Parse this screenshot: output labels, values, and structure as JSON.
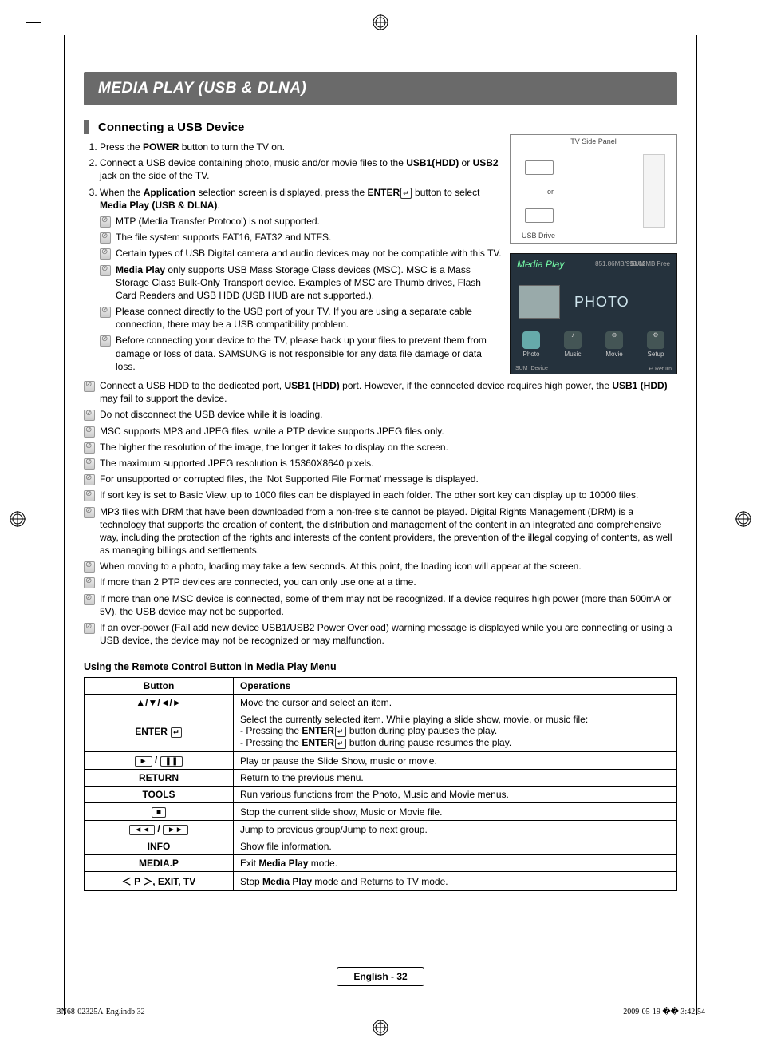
{
  "header": {
    "title": "MEDIA PLAY (USB & DLNA)"
  },
  "subsection": {
    "title": "Connecting a USB Device"
  },
  "steps": {
    "s1_a": "Press the ",
    "s1_b": "POWER",
    "s1_c": " button to turn the TV on.",
    "s2_a": "Connect a USB device containing photo, music and/or movie files to the ",
    "s2_b": "USB1(HDD)",
    "s2_c": " or ",
    "s2_d": "USB2",
    "s2_e": " jack on the side of the TV.",
    "s3_a": "When the ",
    "s3_b": "Application",
    "s3_c": " selection screen is displayed, press the ",
    "s3_d": "ENTER",
    "s3_e": " button to select ",
    "s3_f": "Media Play (USB & DLNA)",
    "s3_g": "."
  },
  "notes": {
    "n1": "MTP (Media Transfer Protocol) is not supported.",
    "n2": "The file system supports FAT16, FAT32 and NTFS.",
    "n3": "Certain types of USB Digital camera and audio devices may not be compatible with this TV.",
    "n4_a": "Media Play",
    "n4_b": " only supports USB Mass Storage Class devices (MSC). MSC is a Mass Storage Class Bulk-Only Transport device. Examples of MSC are Thumb drives, Flash Card Readers and USB HDD (USB HUB are not supported.).",
    "n5": "Please connect directly to the USB port of your TV. If you are using a separate cable connection, there may be a USB compatibility problem.",
    "n6": "Before connecting your device to the TV, please back up your files to prevent them from damage or loss of data. SAMSUNG is not responsible for any data file damage or data loss.",
    "n7_a": "Connect a USB HDD to the dedicated port, ",
    "n7_b": "USB1 (HDD)",
    "n7_c": " port. However, if the connected device requires high power, the ",
    "n7_d": "USB1 (HDD)",
    "n7_e": " may fail to support the device.",
    "n8": "Do not disconnect the USB device while it is loading.",
    "n9": "MSC supports MP3 and JPEG files, while a PTP device supports JPEG files only.",
    "n10": "The higher the resolution of the image, the longer it takes to display on the screen.",
    "n11": "The maximum supported JPEG resolution is 15360X8640 pixels.",
    "n12": "For unsupported or corrupted files, the 'Not Supported File Format' message is displayed.",
    "n13": "If sort key is set to Basic View, up to 1000 files can be displayed in each folder. The other sort key can display up to 10000 files.",
    "n14": "MP3 files with DRM that have been downloaded from a non-free site cannot be played. Digital Rights Management (DRM) is a technology that supports the creation of content, the distribution and management of the content in an integrated and comprehensive way, including the protection of the rights and interests of the content providers, the prevention of the illegal copying of contents, as well as managing billings and settlements.",
    "n15": "When moving to a photo, loading may take a few seconds. At this point, the loading icon will appear at the screen.",
    "n16": "If more than 2 PTP devices are connected, you can only use one at a time.",
    "n17": "If more than one MSC device is connected, some of them may not be recognized. If a device requires high power (more than 500mA or 5V), the USB device may not be supported.",
    "n18": "If an over-power (Fail add new device USB1/USB2 Power Overload) warning message is displayed while you are connecting or using a USB device, the device may not be recognized or may malfunction."
  },
  "remote_heading": "Using the Remote Control Button in Media Play Menu",
  "table": {
    "h1": "Button",
    "h2": "Operations",
    "r1_btn": "▲/▼/◄/►",
    "r1_op": "Move the cursor and select an item.",
    "r2_btn": "ENTER",
    "r2_op_a": "Select the currently selected item. While playing a slide show, movie, or music file:",
    "r2_op_b1": "- Pressing the ",
    "r2_op_b2": "ENTER",
    "r2_op_b3": " button during play pauses the play.",
    "r2_op_c1": "- Pressing the ",
    "r2_op_c2": "ENTER",
    "r2_op_c3": " button during pause resumes the play.",
    "r3_btn": "► / ❚❚",
    "r3_op": "Play or pause the Slide Show, music or movie.",
    "r4_btn": "RETURN",
    "r4_op": "Return to the previous menu.",
    "r5_btn": "TOOLS",
    "r5_op": "Run various functions from the Photo, Music and Movie menus.",
    "r6_btn": "■",
    "r6_op": "Stop the current slide show, Music or Movie file.",
    "r7_btn": "◄◄ / ►►",
    "r7_op": "Jump to previous group/Jump to next group.",
    "r8_btn": "INFO",
    "r8_op": "Show file information.",
    "r9_btn": "MEDIA.P",
    "r9_op_a": "Exit ",
    "r9_op_b": "Media Play",
    "r9_op_c": " mode.",
    "r10_btn": "＜ P ＞, EXIT, TV",
    "r10_op_a": "Stop ",
    "r10_op_b": "Media Play",
    "r10_op_c": " mode and Returns to TV mode."
  },
  "tvpanel": {
    "title": "TV Side Panel",
    "or": "or",
    "usbdrive": "USB Drive"
  },
  "mediaui": {
    "title": "Media Play",
    "sum": "SUM",
    "device_info": "851.86MB/993.02MB Free",
    "big": "PHOTO",
    "items": {
      "photo": "Photo",
      "music": "Music",
      "movie": "Movie",
      "setup": "Setup"
    },
    "foot_left": "SUM",
    "foot_device": "Device",
    "foot_right": "Return"
  },
  "footer": {
    "page": "English - 32",
    "doc": "BN68-02325A-Eng.indb   32",
    "ts": "2009-05-19   �� 3:42:54"
  }
}
